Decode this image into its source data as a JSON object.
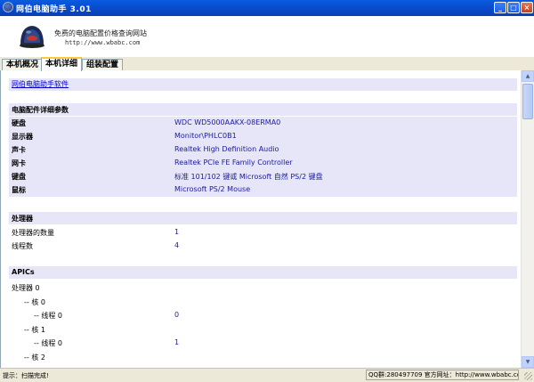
{
  "window": {
    "title": "网伯电脑助手 3.01",
    "buttons": [
      "_",
      "□",
      "×"
    ]
  },
  "header": {
    "slogan": "免费的电脑配置价格查询网站",
    "url": "http://www.wbabc.com"
  },
  "tabs": [
    {
      "label": "本机概况",
      "active": false
    },
    {
      "label": "本机详细",
      "active": true
    },
    {
      "label": "组装配置",
      "active": false
    }
  ],
  "content": {
    "link": "网伯电脑助手软件",
    "hardware": {
      "title": "电脑配件详细参数",
      "rows": [
        {
          "key": "硬盘",
          "value": "WDC WD5000AAKX-08ERMA0"
        },
        {
          "key": "显示器",
          "value": "Monitor\\PHLC0B1"
        },
        {
          "key": "声卡",
          "value": "Realtek High Definition Audio"
        },
        {
          "key": "网卡",
          "value": "Realtek PCIe FE Family Controller"
        },
        {
          "key": "键盘",
          "value": "标准 101/102 键或 Microsoft 自然 PS/2 键盘"
        },
        {
          "key": "鼠标",
          "value": "Microsoft PS/2 Mouse"
        }
      ]
    },
    "cpu": {
      "title": "处理器",
      "rows": [
        {
          "key": "处理器的数量",
          "value": "1"
        },
        {
          "key": "线程数",
          "value": "4"
        }
      ]
    },
    "apics": {
      "title": "APICs",
      "rows": [
        {
          "key": "处理器 0",
          "value": ""
        },
        {
          "key": "-- 核 0",
          "value": ""
        },
        {
          "key": "-- 线程 0",
          "value": "0"
        },
        {
          "key": "-- 核 1",
          "value": ""
        },
        {
          "key": "-- 线程 0",
          "value": "1"
        },
        {
          "key": "-- 核 2",
          "value": ""
        }
      ]
    }
  },
  "status": {
    "left": "提示：扫描完成!",
    "right": "QQ群:280497709 官方网址：http://www.wbabc.com"
  },
  "colors": {
    "titlebar": "#0A5BE0",
    "section_bg": "#E6E6F8",
    "value_text": "#1A1AA0",
    "link": "#0000CC"
  }
}
